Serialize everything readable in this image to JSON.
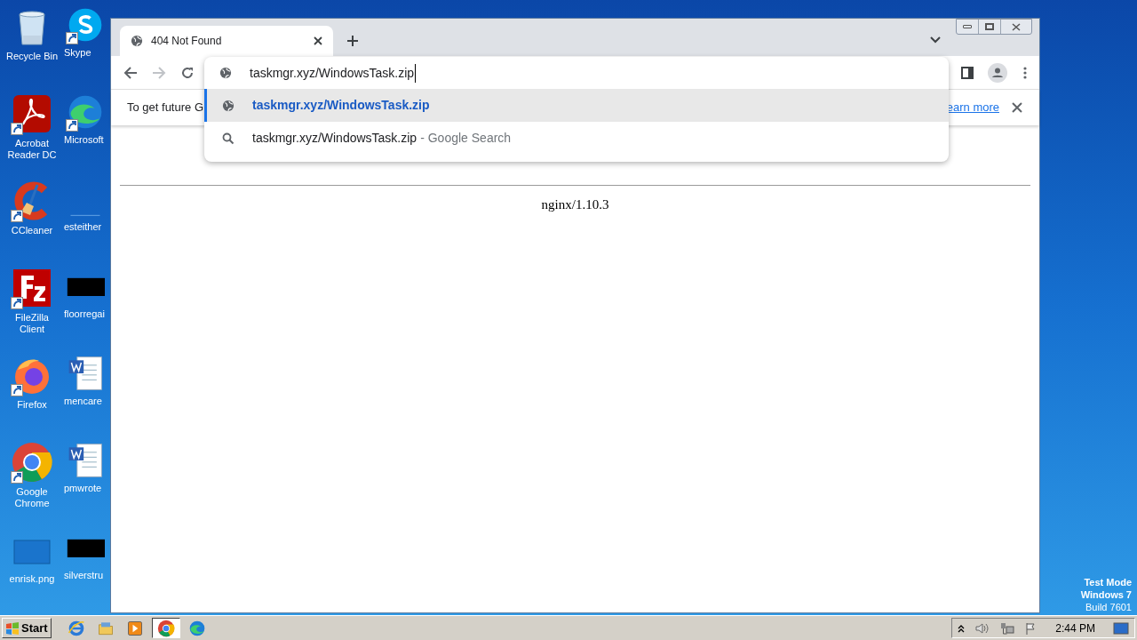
{
  "desktop": {
    "column_1": [
      {
        "label": "Recycle Bin",
        "kind": "recycle",
        "shortcut": false
      },
      {
        "label": "Acrobat Reader DC",
        "kind": "acrobat",
        "shortcut": true
      },
      {
        "label": "CCleaner",
        "kind": "ccleaner",
        "shortcut": true
      },
      {
        "label": "FileZilla Client",
        "kind": "filezilla",
        "shortcut": true
      },
      {
        "label": "Firefox",
        "kind": "firefox",
        "shortcut": true
      },
      {
        "label": "Google Chrome",
        "kind": "chrome",
        "shortcut": true
      },
      {
        "label": "enrisk.png",
        "kind": "image",
        "shortcut": false
      }
    ],
    "column_2": [
      {
        "label": "Skype",
        "kind": "skype",
        "shortcut": true
      },
      {
        "label": "Microsoft",
        "kind": "edge",
        "shortcut": true
      },
      {
        "label": "esteither",
        "kind": "blank",
        "shortcut": false
      },
      {
        "label": "floorregai",
        "kind": "black",
        "shortcut": false
      },
      {
        "label": "mencare",
        "kind": "word",
        "shortcut": false
      },
      {
        "label": "pmwrote",
        "kind": "word",
        "shortcut": false
      },
      {
        "label": "silverstru",
        "kind": "black",
        "shortcut": false
      }
    ]
  },
  "browser": {
    "tabs": [
      {
        "title": "404 Not Found",
        "selected": true
      }
    ],
    "omnibox": {
      "value": "taskmgr.xyz/WindowsTask.zip"
    },
    "suggestions": [
      {
        "kind": "url",
        "text": "taskmgr.xyz/WindowsTask.zip",
        "selected": true
      },
      {
        "kind": "search",
        "text": "taskmgr.xyz/WindowsTask.zip",
        "suffix": "- Google Search",
        "selected": false
      }
    ],
    "infobar": {
      "text": "To get future G",
      "link": "earn more"
    },
    "page": {
      "footer": "nginx/1.10.3"
    }
  },
  "taskbar": {
    "start": "Start",
    "apps": [
      {
        "kind": "ie",
        "active": false
      },
      {
        "kind": "explorer",
        "active": false
      },
      {
        "kind": "media",
        "active": false
      },
      {
        "kind": "chrome",
        "active": true
      },
      {
        "kind": "edge",
        "active": false
      }
    ],
    "clock": "2:44 PM"
  },
  "watermark": {
    "lines": [
      "Test Mode",
      "Windows 7",
      "Build 7601"
    ]
  }
}
